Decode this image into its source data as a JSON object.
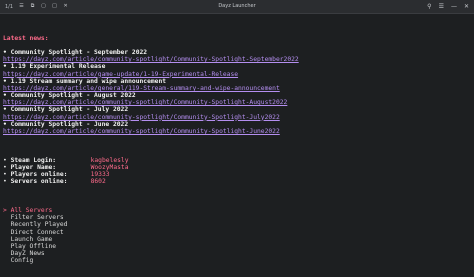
{
  "window": {
    "title": "Dayz Launcher",
    "tab_counter": "1/1"
  },
  "news": {
    "heading": "Latest news:",
    "items": [
      {
        "title": "Community Spotlight - September 2022",
        "url": "https://dayz.com/article/community-spotlight/Community-Spotlight-September2022"
      },
      {
        "title": "1.19 Experimental Release",
        "url": "https://dayz.com/article/game-update/1-19-Experimental-Release"
      },
      {
        "title": "1.19 Stream summary and wipe announcement",
        "url": "https://dayz.com/article/general/119-Stream-summary-and-wipe-announcement"
      },
      {
        "title": "Community Spotlight - August 2022",
        "url": "https://dayz.com/article/community-spotlight/Community-Spotlight-August2022"
      },
      {
        "title": "Community Spotlight - July 2022",
        "url": "https://dayz.com/article/community-spotlight/Community-Spotlight-July2022"
      },
      {
        "title": "Community Spotlight - June 2022",
        "url": "https://dayz.com/article/community-spotlight/Community-Spotlight-June2022"
      }
    ]
  },
  "stats": [
    {
      "label": "Steam Login:",
      "value": "kagbelesly"
    },
    {
      "label": "Player Name:",
      "value": "WoozyMasta"
    },
    {
      "label": "Players online:",
      "value": "19333"
    },
    {
      "label": "Servers online:",
      "value": "8602"
    }
  ],
  "menu": {
    "cursor": ">",
    "items": [
      "All Servers",
      "Filter Servers",
      "Recently Played",
      "Direct Connect",
      "Launch Game",
      "Play Offline",
      "DayZ News",
      "Config"
    ],
    "selected_index": 0
  }
}
